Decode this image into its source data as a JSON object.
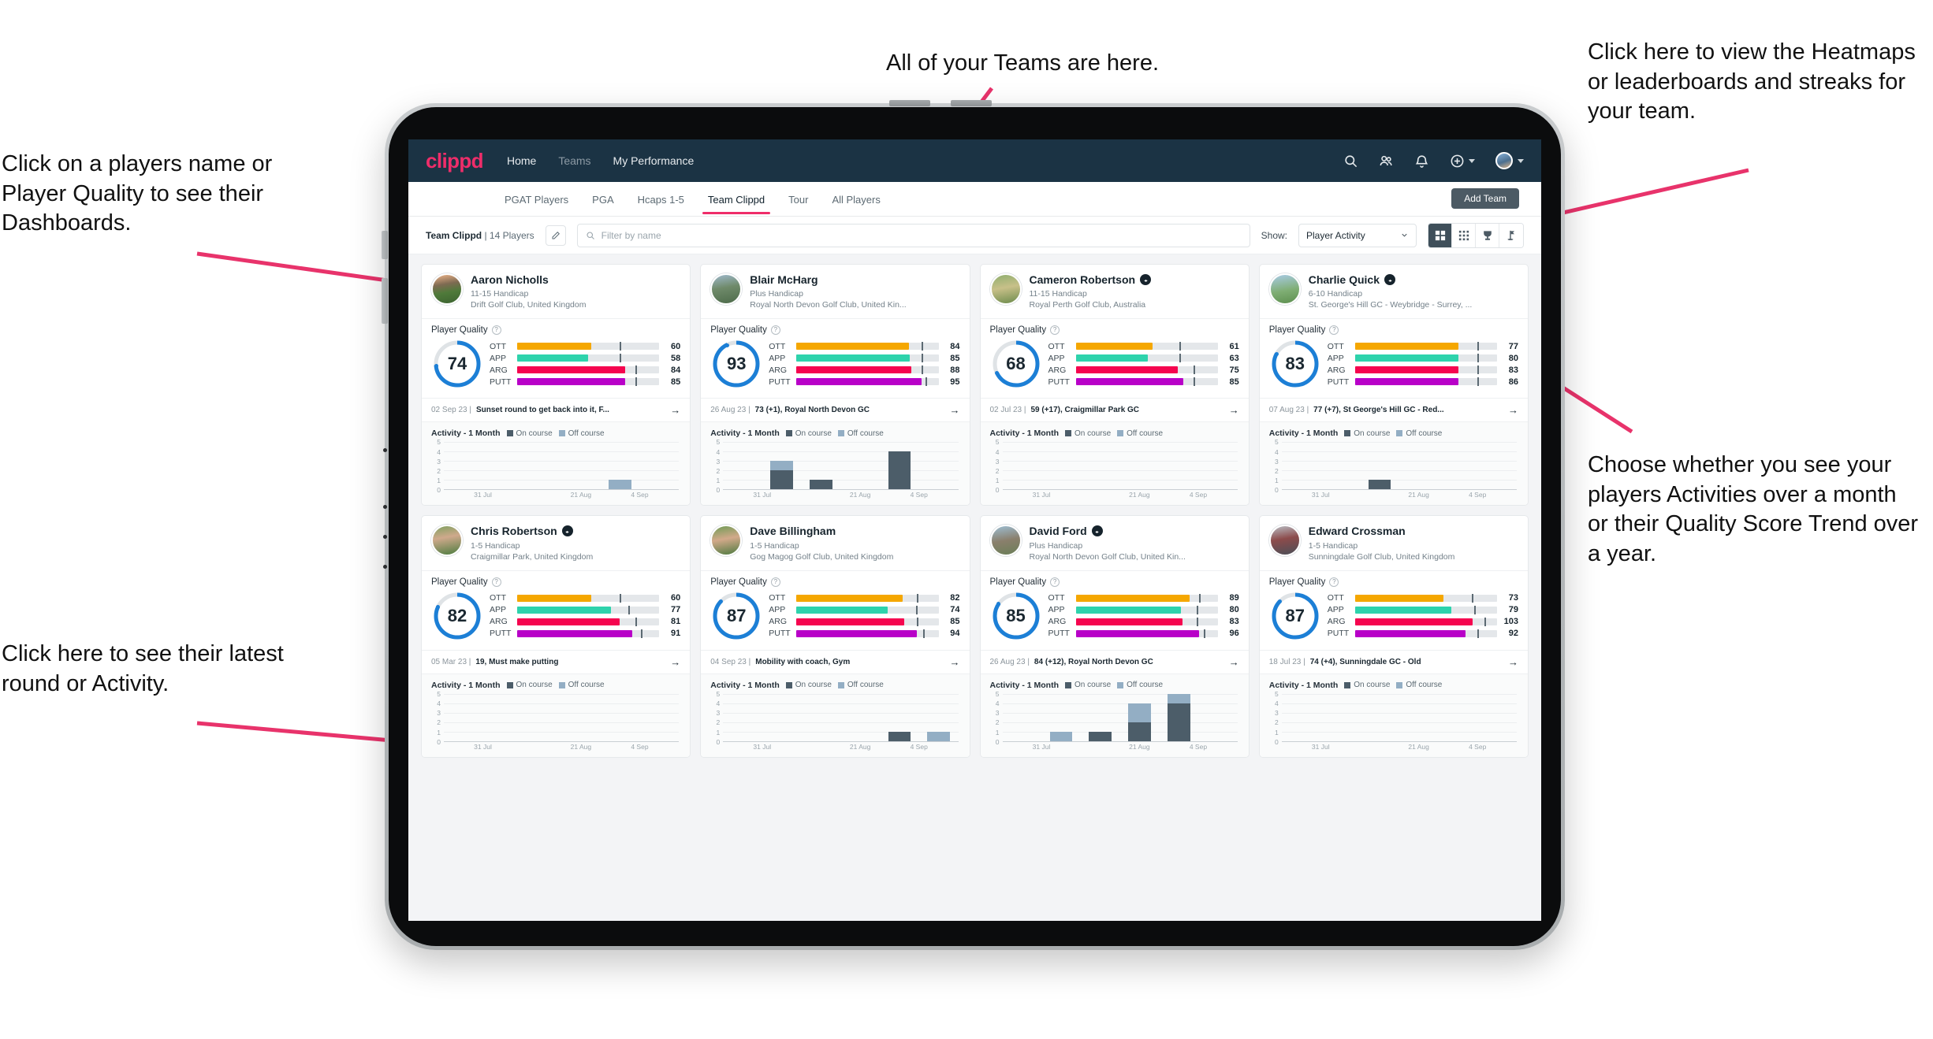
{
  "annotations": {
    "top_left": "Click on a players name or Player Quality to see their Dashboards.",
    "bottom_left": "Click here to see their latest round or Activity.",
    "top_center": "All of your Teams are here.",
    "top_right": "Click here to view the Heatmaps or leaderboards and streaks for your team.",
    "bottom_right": "Choose whether you see your players Activities over a month or their Quality Score Trend over a year."
  },
  "navbar": {
    "logo": "clippd",
    "links": [
      {
        "label": "Home",
        "active": true
      },
      {
        "label": "Teams",
        "active": false
      },
      {
        "label": "My Performance",
        "active": true
      }
    ],
    "icons": [
      "search-icon",
      "people-icon",
      "bell-icon",
      "plus-circle-icon",
      "avatar"
    ]
  },
  "tabs": [
    {
      "label": "PGAT Players",
      "active": false
    },
    {
      "label": "PGA",
      "active": false
    },
    {
      "label": "Hcaps 1-5",
      "active": false
    },
    {
      "label": "Team Clippd",
      "active": true
    },
    {
      "label": "Tour",
      "active": false
    },
    {
      "label": "All Players",
      "active": false
    }
  ],
  "add_team_label": "Add Team",
  "toolbar": {
    "team_name": "Team Clippd",
    "team_count": "| 14 Players",
    "search_placeholder": "Filter by name",
    "show_label": "Show:",
    "show_value": "Player Activity",
    "views": [
      {
        "name": "grid-view-icon",
        "active": true
      },
      {
        "name": "dense-grid-view-icon",
        "active": false
      },
      {
        "name": "trophy-leaderboard-icon",
        "active": false
      },
      {
        "name": "flag-streak-icon",
        "active": false
      }
    ]
  },
  "card_labels": {
    "player_quality": "Player Quality",
    "activity": "Activity - 1 Month",
    "legend_on": "On course",
    "legend_off": "Off course",
    "metric_names": [
      "OTT",
      "APP",
      "ARG",
      "PUTT"
    ],
    "x_ticks": [
      "31 Jul",
      "21 Aug",
      "4 Sep"
    ],
    "y_ticks": [
      "5",
      "4",
      "3",
      "2",
      "1",
      "0"
    ]
  },
  "colors": {
    "brand_pink": "#ef2d6a",
    "navy": "#1b3344",
    "ring_blue": "#1c7fd6",
    "ott": "#f5a700",
    "app": "#2ed3ac",
    "arg": "#f5054f",
    "putt": "#b800c8",
    "on_course": "#4c5d69",
    "off_course": "#93aec4"
  },
  "players": [
    {
      "name": "Aaron Nicholls",
      "verified": false,
      "handicap": "11-15 Handicap",
      "club": "Drift Golf Club, United Kingdom",
      "quality": 74,
      "metrics": [
        {
          "label": "OTT",
          "value": 60,
          "fill": 52,
          "tick": 72
        },
        {
          "label": "APP",
          "value": 58,
          "fill": 50,
          "tick": 72
        },
        {
          "label": "ARG",
          "value": 84,
          "fill": 76,
          "tick": 83
        },
        {
          "label": "PUTT",
          "value": 85,
          "fill": 76,
          "tick": 83
        }
      ],
      "latest_date": "02 Sep 23 |",
      "latest_text": "Sunset round to get back into it, F...",
      "activity": [
        {
          "on": 0,
          "off": 0
        },
        {
          "on": 0,
          "off": 0
        },
        {
          "on": 0,
          "off": 0
        },
        {
          "on": 0,
          "off": 0
        },
        {
          "on": 0,
          "off": 1
        },
        {
          "on": 0,
          "off": 0
        }
      ]
    },
    {
      "name": "Blair McHarg",
      "verified": false,
      "handicap": "Plus Handicap",
      "club": "Royal North Devon Golf Club, United Kin...",
      "quality": 93,
      "metrics": [
        {
          "label": "OTT",
          "value": 84,
          "fill": 79,
          "tick": 88
        },
        {
          "label": "APP",
          "value": 85,
          "fill": 80,
          "tick": 88
        },
        {
          "label": "ARG",
          "value": 88,
          "fill": 81,
          "tick": 88
        },
        {
          "label": "PUTT",
          "value": 95,
          "fill": 88,
          "tick": 91
        }
      ],
      "latest_date": "26 Aug 23 |",
      "latest_text": "73 (+1), Royal North Devon GC",
      "activity": [
        {
          "on": 0,
          "off": 0
        },
        {
          "on": 2,
          "off": 1
        },
        {
          "on": 1,
          "off": 0
        },
        {
          "on": 0,
          "off": 0
        },
        {
          "on": 4,
          "off": 0
        },
        {
          "on": 0,
          "off": 0
        }
      ]
    },
    {
      "name": "Cameron Robertson",
      "verified": true,
      "handicap": "11-15 Handicap",
      "club": "Royal Perth Golf Club, Australia",
      "quality": 68,
      "metrics": [
        {
          "label": "OTT",
          "value": 61,
          "fill": 54,
          "tick": 73
        },
        {
          "label": "APP",
          "value": 63,
          "fill": 51,
          "tick": 73
        },
        {
          "label": "ARG",
          "value": 75,
          "fill": 72,
          "tick": 83
        },
        {
          "label": "PUTT",
          "value": 85,
          "fill": 76,
          "tick": 83
        }
      ],
      "latest_date": "02 Jul 23 |",
      "latest_text": "59 (+17), Craigmillar Park GC",
      "activity": [
        {
          "on": 0,
          "off": 0
        },
        {
          "on": 0,
          "off": 0
        },
        {
          "on": 0,
          "off": 0
        },
        {
          "on": 0,
          "off": 0
        },
        {
          "on": 0,
          "off": 0
        },
        {
          "on": 0,
          "off": 0
        }
      ]
    },
    {
      "name": "Charlie Quick",
      "verified": true,
      "handicap": "6-10 Handicap",
      "club": "St. George's Hill GC - Weybridge - Surrey, ...",
      "quality": 83,
      "metrics": [
        {
          "label": "OTT",
          "value": 77,
          "fill": 73,
          "tick": 86
        },
        {
          "label": "APP",
          "value": 80,
          "fill": 73,
          "tick": 86
        },
        {
          "label": "ARG",
          "value": 83,
          "fill": 73,
          "tick": 86
        },
        {
          "label": "PUTT",
          "value": 86,
          "fill": 73,
          "tick": 86
        }
      ],
      "latest_date": "07 Aug 23 |",
      "latest_text": "77 (+7), St George's Hill GC - Red...",
      "activity": [
        {
          "on": 0,
          "off": 0
        },
        {
          "on": 0,
          "off": 0
        },
        {
          "on": 1,
          "off": 0
        },
        {
          "on": 0,
          "off": 0
        },
        {
          "on": 0,
          "off": 0
        },
        {
          "on": 0,
          "off": 0
        }
      ]
    },
    {
      "name": "Chris Robertson",
      "verified": true,
      "handicap": "1-5 Handicap",
      "club": "Craigmillar Park, United Kingdom",
      "quality": 82,
      "metrics": [
        {
          "label": "OTT",
          "value": 60,
          "fill": 52,
          "tick": 72
        },
        {
          "label": "APP",
          "value": 77,
          "fill": 66,
          "tick": 78
        },
        {
          "label": "ARG",
          "value": 81,
          "fill": 72,
          "tick": 83
        },
        {
          "label": "PUTT",
          "value": 91,
          "fill": 81,
          "tick": 87
        }
      ],
      "latest_date": "05 Mar 23 |",
      "latest_text": "19, Must make putting",
      "activity": [
        {
          "on": 0,
          "off": 0
        },
        {
          "on": 0,
          "off": 0
        },
        {
          "on": 0,
          "off": 0
        },
        {
          "on": 0,
          "off": 0
        },
        {
          "on": 0,
          "off": 0
        },
        {
          "on": 0,
          "off": 0
        }
      ]
    },
    {
      "name": "Dave Billingham",
      "verified": false,
      "handicap": "1-5 Handicap",
      "club": "Gog Magog Golf Club, United Kingdom",
      "quality": 87,
      "metrics": [
        {
          "label": "OTT",
          "value": 82,
          "fill": 75,
          "tick": 85
        },
        {
          "label": "APP",
          "value": 74,
          "fill": 64,
          "tick": 84
        },
        {
          "label": "ARG",
          "value": 85,
          "fill": 76,
          "tick": 85
        },
        {
          "label": "PUTT",
          "value": 94,
          "fill": 85,
          "tick": 89
        }
      ],
      "latest_date": "04 Sep 23 |",
      "latest_text": "Mobility with coach, Gym",
      "activity": [
        {
          "on": 0,
          "off": 0
        },
        {
          "on": 0,
          "off": 0
        },
        {
          "on": 0,
          "off": 0
        },
        {
          "on": 0,
          "off": 0
        },
        {
          "on": 1,
          "off": 0
        },
        {
          "on": 0,
          "off": 1
        }
      ]
    },
    {
      "name": "David Ford",
      "verified": true,
      "handicap": "Plus Handicap",
      "club": "Royal North Devon Golf Club, United Kin...",
      "quality": 85,
      "metrics": [
        {
          "label": "OTT",
          "value": 89,
          "fill": 80,
          "tick": 87
        },
        {
          "label": "APP",
          "value": 80,
          "fill": 74,
          "tick": 85
        },
        {
          "label": "ARG",
          "value": 83,
          "fill": 75,
          "tick": 85
        },
        {
          "label": "PUTT",
          "value": 96,
          "fill": 87,
          "tick": 90
        }
      ],
      "latest_date": "26 Aug 23 |",
      "latest_text": "84 (+12), Royal North Devon GC",
      "activity": [
        {
          "on": 0,
          "off": 0
        },
        {
          "on": 0,
          "off": 1
        },
        {
          "on": 1,
          "off": 0
        },
        {
          "on": 2,
          "off": 2
        },
        {
          "on": 4,
          "off": 1
        },
        {
          "on": 0,
          "off": 0
        }
      ]
    },
    {
      "name": "Edward Crossman",
      "verified": false,
      "handicap": "1-5 Handicap",
      "club": "Sunningdale Golf Club, United Kingdom",
      "quality": 87,
      "metrics": [
        {
          "label": "OTT",
          "value": 73,
          "fill": 62,
          "tick": 82
        },
        {
          "label": "APP",
          "value": 79,
          "fill": 68,
          "tick": 84
        },
        {
          "label": "ARG",
          "value": 103,
          "fill": 83,
          "tick": 91
        },
        {
          "label": "PUTT",
          "value": 92,
          "fill": 78,
          "tick": 86
        }
      ],
      "latest_date": "18 Jul 23 |",
      "latest_text": "74 (+4), Sunningdale GC - Old",
      "activity": [
        {
          "on": 0,
          "off": 0
        },
        {
          "on": 0,
          "off": 0
        },
        {
          "on": 0,
          "off": 0
        },
        {
          "on": 0,
          "off": 0
        },
        {
          "on": 0,
          "off": 0
        },
        {
          "on": 0,
          "off": 0
        }
      ]
    }
  ]
}
